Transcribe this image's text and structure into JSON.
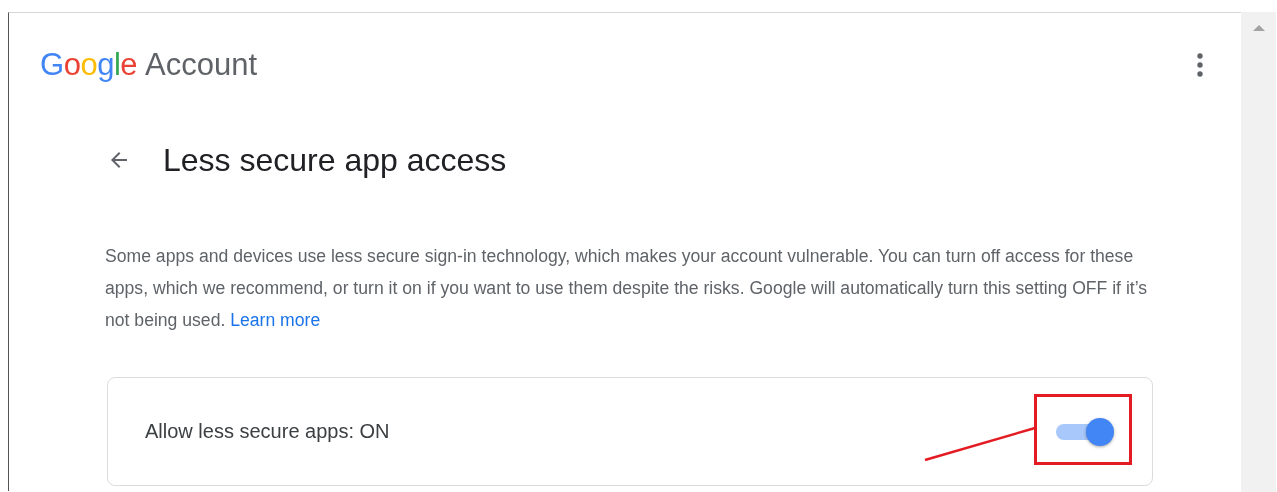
{
  "header": {
    "logo": "Google",
    "product": "Account"
  },
  "page": {
    "title": "Less secure app access"
  },
  "description": {
    "text": "Some apps and devices use less secure sign-in technology, which makes your account vulnerable. You can turn off access for these apps, which we recommend, or turn it on if you want to use them despite the risks. Google will automatically turn this setting OFF if it’s not being used.",
    "link": "Learn more"
  },
  "setting": {
    "label": "Allow less secure apps: ON",
    "on": true
  },
  "annotation": {
    "highlighted": true
  }
}
